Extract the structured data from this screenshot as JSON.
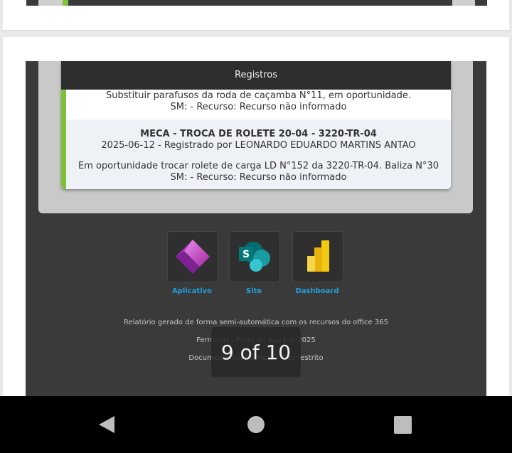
{
  "records_card": {
    "header": "Registros",
    "record1": {
      "line1": "Substituir parafusos da roda de caçamba N°11, em oportunidade.",
      "line2": "SM: - Recurso: Recurso não informado"
    },
    "record2": {
      "title": "MECA - TROCA DE ROLETE 20-04 - 3220-TR-04",
      "meta": "2025-06-12 - Registrado por LEONARDO EDUARDO MARTINS ANTAO",
      "desc": "Em oportunidade trocar rolete de carga LD N°152 da 3220-TR-04. Baliza N°30",
      "resource": "SM: - Recurso: Recurso não informado"
    }
  },
  "apps": [
    {
      "label": "Aplicativo",
      "icon": "power-apps-icon"
    },
    {
      "label": "Site",
      "icon": "sharepoint-icon"
    },
    {
      "label": "Dashboard",
      "icon": "power-bi-icon"
    }
  ],
  "footer": {
    "generated": "Relatório gerado de forma semi-automática com os recursos do office 365",
    "company": "Ferroport - Porto do Açu | © 2025",
    "confidential": "Documento confidencial - Uso restrito"
  },
  "page_counter": "9 of 10",
  "colors": {
    "accent_green": "#7dc13a",
    "link_blue": "#1ea2df",
    "email_dark": "#3a3a3a"
  }
}
